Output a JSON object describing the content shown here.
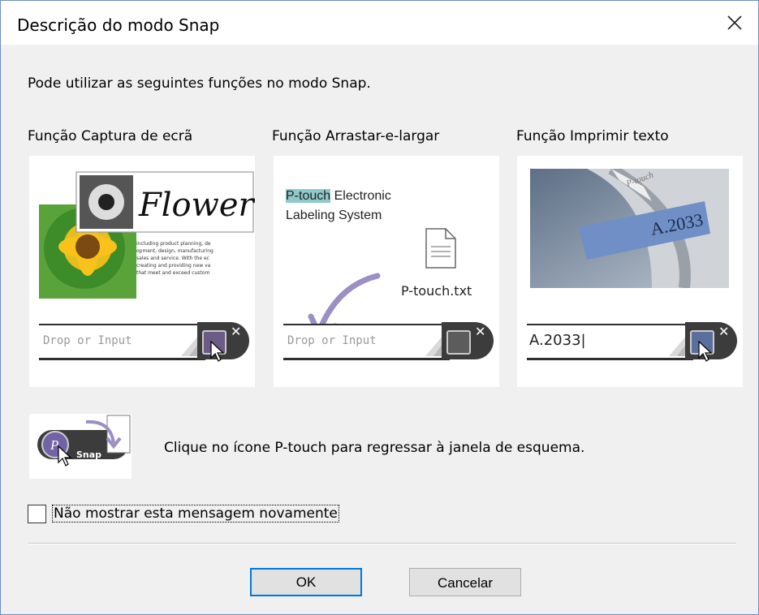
{
  "window": {
    "title": "Descrição do modo Snap",
    "close_icon": "close-icon"
  },
  "intro": "Pode utilizar as seguintes funções no modo Snap.",
  "columns": [
    {
      "title": "Função Captura de ecrã",
      "heading": "Flower",
      "body_lines": [
        "including product planning, de",
        "opment, design, manufacturing",
        "sales and service. With the ec",
        "creating and providing new va",
        "that meet and exceed custom"
      ],
      "input_placeholder": "Drop or Input"
    },
    {
      "title": "Função Arrastar-e-largar",
      "highlight": "P-touch",
      "rest_line1": " Electronic",
      "line2": "Labeling System",
      "file_name": "P-touch.txt",
      "input_placeholder": "Drop or Input"
    },
    {
      "title": "Função Imprimir texto",
      "photo_label": "A.2033",
      "tape_brand": "P-touch",
      "input_value": "A.2033|"
    }
  ],
  "snap": {
    "label": "Snap",
    "text": "Clique no ícone P-touch para regressar à janela de esquema."
  },
  "checkbox": {
    "label": "Não mostrar esta mensagem novamente",
    "checked": false
  },
  "buttons": {
    "ok": "OK",
    "cancel": "Cancelar"
  },
  "colors": {
    "accent": "#0078d7",
    "highlight": "#8fc9c9",
    "arrow": "#9b8fc4",
    "photo_tape": "#6f8fc6"
  }
}
